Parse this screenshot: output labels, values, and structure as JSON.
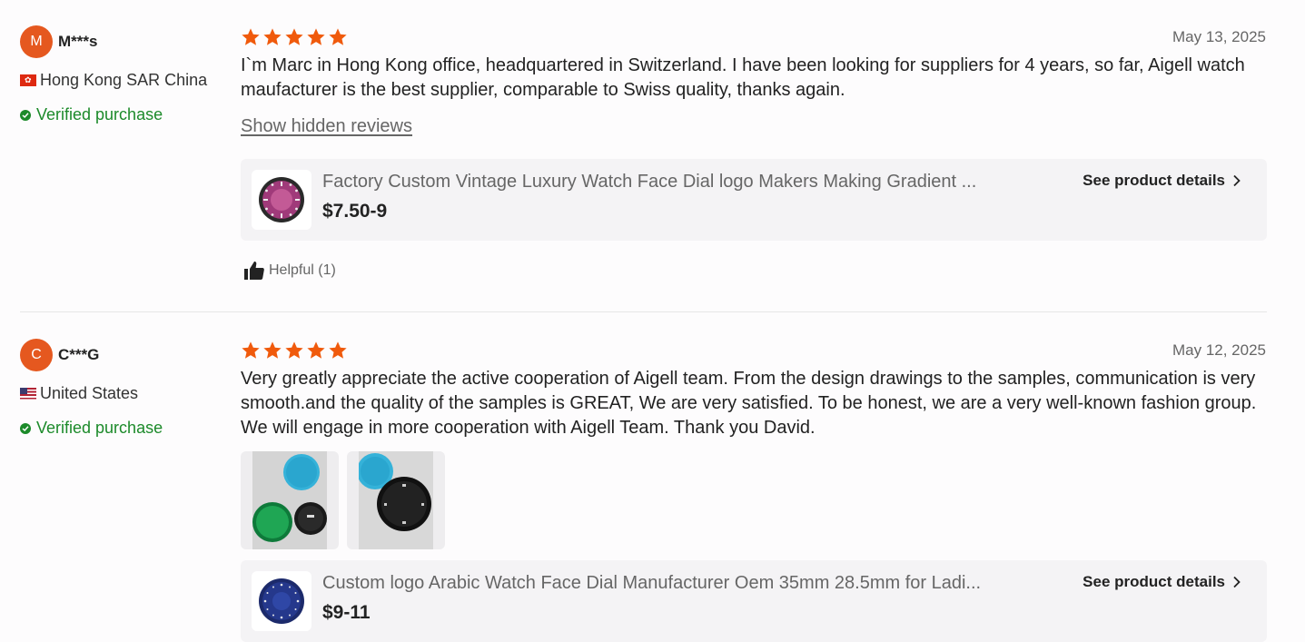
{
  "reviews": [
    {
      "avatar_letter": "M",
      "username": "M***s",
      "country": "Hong Kong SAR China",
      "verified": "Verified purchase",
      "rating": 5,
      "date": "May 13, 2025",
      "text": "I`m Marc in Hong Kong office, headquartered in Switzerland. I have been looking for suppliers for 4 years, so far, Aigell watch maufacturer is the best supplier, comparable to Swiss quality, thanks again.",
      "show_hidden": "Show hidden reviews",
      "product": {
        "title": "Factory Custom Vintage Luxury Watch Face Dial logo Makers Making Gradient ...",
        "price": "$7.50-9",
        "details_label": "See product details"
      },
      "helpful": "Helpful (1)"
    },
    {
      "avatar_letter": "C",
      "username": "C***G",
      "country": "United States",
      "verified": "Verified purchase",
      "rating": 5,
      "date": "May 12, 2025",
      "text": "Very greatly appreciate the active cooperation of Aigell team. From the design drawings to the samples, communication is very smooth.and the quality of the samples is GREAT, We are very satisfied.  To be honest, we are a very well-known fashion group. We will engage in more cooperation with Aigell Team. Thank you David.",
      "product": {
        "title": "Custom logo Arabic Watch Face Dial Manufacturer Oem 35mm 28.5mm for Ladi...",
        "price": "$9-11",
        "details_label": "See product details"
      }
    }
  ],
  "colors": {
    "star": "#f05a0c",
    "avatar": "#e5581f",
    "verified": "#1c8a2a"
  }
}
